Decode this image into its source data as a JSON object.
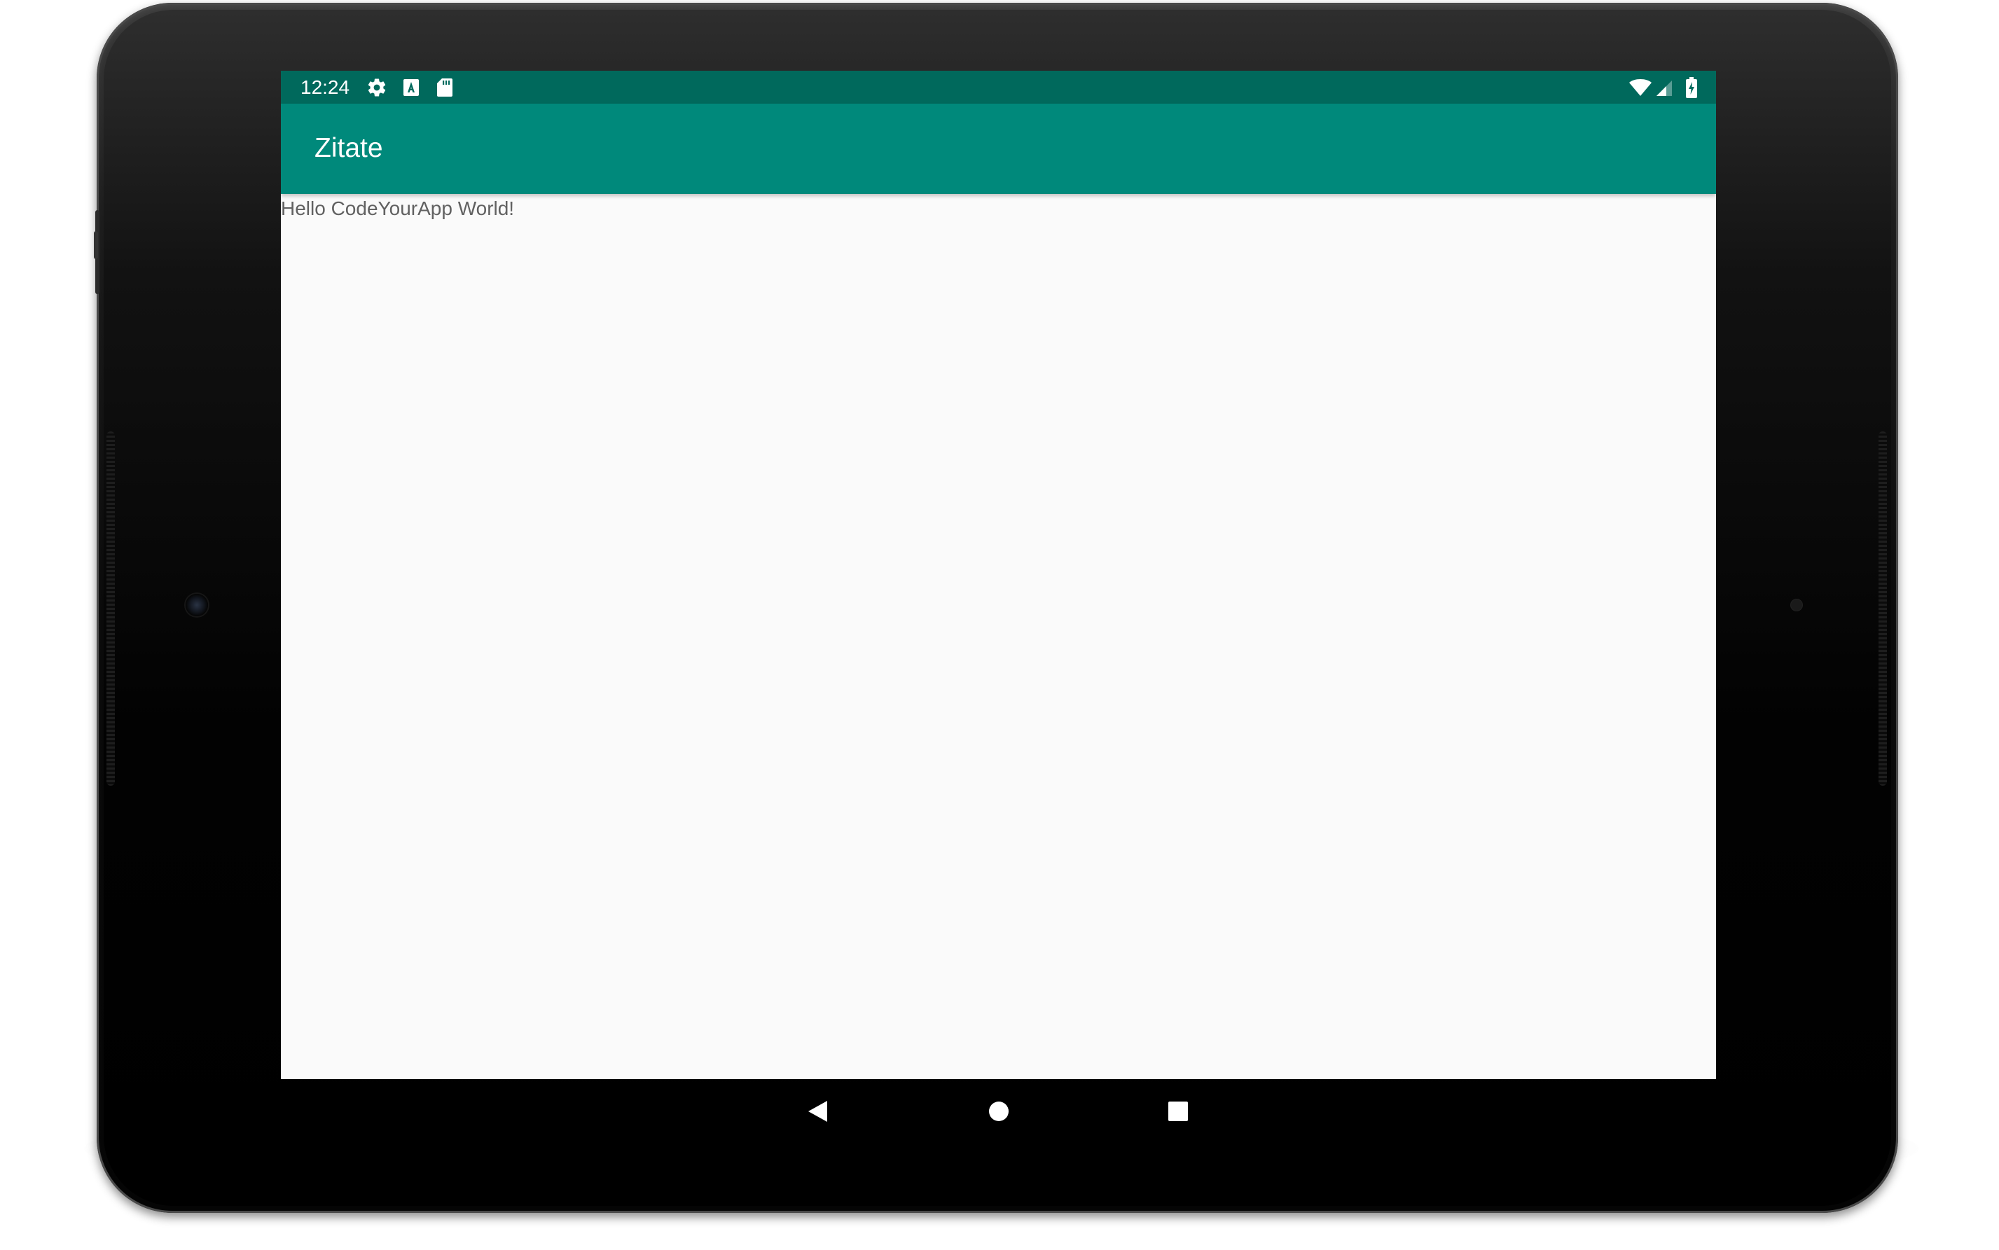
{
  "status_bar": {
    "time": "12:24",
    "left_icons": [
      "settings-icon",
      "keyboard-a-icon",
      "sd-card-icon"
    ],
    "right_icons": [
      "wifi-icon",
      "cell-signal-icon",
      "battery-charging-icon"
    ]
  },
  "app_bar": {
    "title": "Zitate"
  },
  "content": {
    "text": "Hello CodeYourApp World!"
  },
  "nav_bar": {
    "buttons": [
      "back-icon",
      "home-icon",
      "recents-icon"
    ]
  },
  "colors": {
    "status_bar": "#00695c",
    "app_bar": "#00897b",
    "screen_background": "#fafafa",
    "body_text": "#616161"
  }
}
